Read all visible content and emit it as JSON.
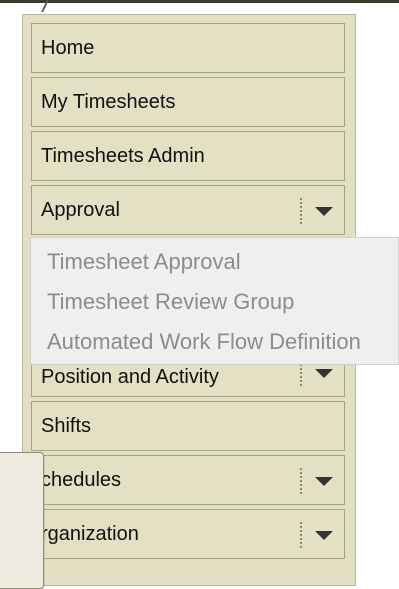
{
  "menu": {
    "items": [
      {
        "label": "Home"
      },
      {
        "label": "My Timesheets"
      },
      {
        "label": "Timesheets Admin"
      },
      {
        "label": "Approval"
      },
      {
        "label": "Position and Activity"
      },
      {
        "label": "Shifts"
      },
      {
        "label": "chedules"
      },
      {
        "label": "rganization"
      }
    ]
  },
  "approval_submenu": {
    "items": [
      {
        "label": "Timesheet Approval"
      },
      {
        "label": "Timesheet Review Group"
      },
      {
        "label": "Automated Work Flow Definition"
      }
    ]
  },
  "colors": {
    "menu_bg": "#e4e0c4",
    "menu_border": "#a6a38d",
    "popup_bg": "#efefef",
    "popup_text": "#8c8c8c"
  }
}
